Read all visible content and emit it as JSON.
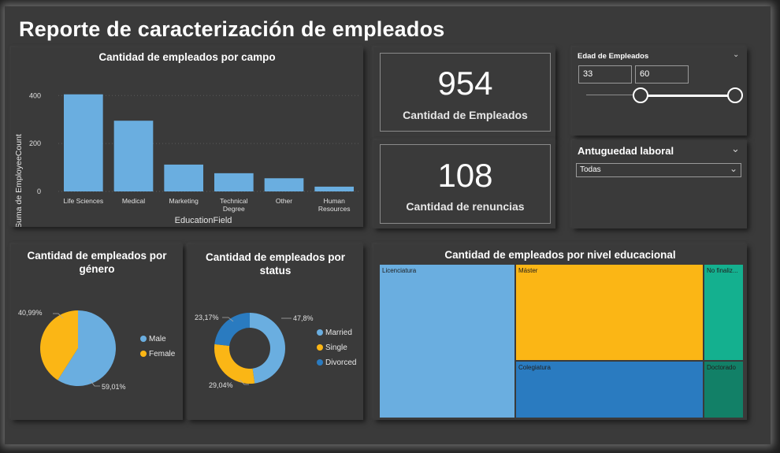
{
  "page": {
    "title": "Reporte de caracterización de empleados"
  },
  "colors": {
    "blue_light": "#6aaee0",
    "yellow": "#fbb615",
    "blue_dark": "#2a7bc0",
    "teal": "#14b08f",
    "teal_dark": "#128067"
  },
  "bar_panel": {
    "title": "Cantidad de empleados por campo",
    "ylabel": "Suma de EmployeeCount",
    "xlabel": "EducationField",
    "yticks": [
      "400",
      "200",
      "0"
    ]
  },
  "chart_data": [
    {
      "type": "bar",
      "title": "Cantidad de empleados por campo",
      "xlabel": "EducationField",
      "ylabel": "Suma de EmployeeCount",
      "categories": [
        "Life Sciences",
        "Medical",
        "Marketing",
        "Technical Degree",
        "Other",
        "Human Resources"
      ],
      "values": [
        405,
        295,
        112,
        76,
        55,
        20
      ],
      "ylim": [
        0,
        460
      ],
      "yticks": [
        0,
        200,
        400
      ],
      "grid": true
    },
    {
      "type": "pie",
      "title": "Cantidad de empleados por género",
      "labels": [
        "Male",
        "Female"
      ],
      "values": [
        59.01,
        40.99
      ],
      "data_labels": [
        "59,01%",
        "40,99%"
      ],
      "legend": "right"
    },
    {
      "type": "pie",
      "subtype": "donut",
      "title": "Cantidad de empleados por status",
      "labels": [
        "Married",
        "Single",
        "Divorced"
      ],
      "values": [
        47.8,
        29.04,
        23.17
      ],
      "data_labels": [
        "47,8%",
        "29,04%",
        "23,17%"
      ],
      "legend": "right"
    },
    {
      "type": "treemap",
      "title": "Cantidad de empleados por nivel educacional",
      "labels": [
        "Licenciatura",
        "Máster",
        "Colegiatura",
        "No finaliz...",
        "Doctorado"
      ]
    }
  ],
  "kpis": [
    {
      "value": "954",
      "label": "Cantidad de Empleados"
    },
    {
      "value": "108",
      "label": "Cantidad de renuncias"
    }
  ],
  "age_slicer": {
    "title": "Edad de Empleados",
    "min": "33",
    "max": "60",
    "range_min": 18,
    "range_max": 60
  },
  "tenure_slicer": {
    "title": "Antuguedad laboral",
    "selected": "Todas"
  },
  "gender_panel": {
    "title_line1": "Cantidad de empleados por",
    "title_line2": "género",
    "label_male": "59,01%",
    "label_female": "40,99%",
    "legend": [
      "Male",
      "Female"
    ]
  },
  "status_panel": {
    "title_line1": "Cantidad de empleados por",
    "title_line2": "status",
    "label_married": "47,8%",
    "label_single": "29,04%",
    "label_divorced": "23,17%",
    "legend": [
      "Married",
      "Single",
      "Divorced"
    ]
  },
  "treemap_panel": {
    "title": "Cantidad de empleados por nivel educacional",
    "tiles": [
      "Licenciatura",
      "Máster",
      "Colegiatura",
      "No finaliz...",
      "Doctorado"
    ]
  }
}
